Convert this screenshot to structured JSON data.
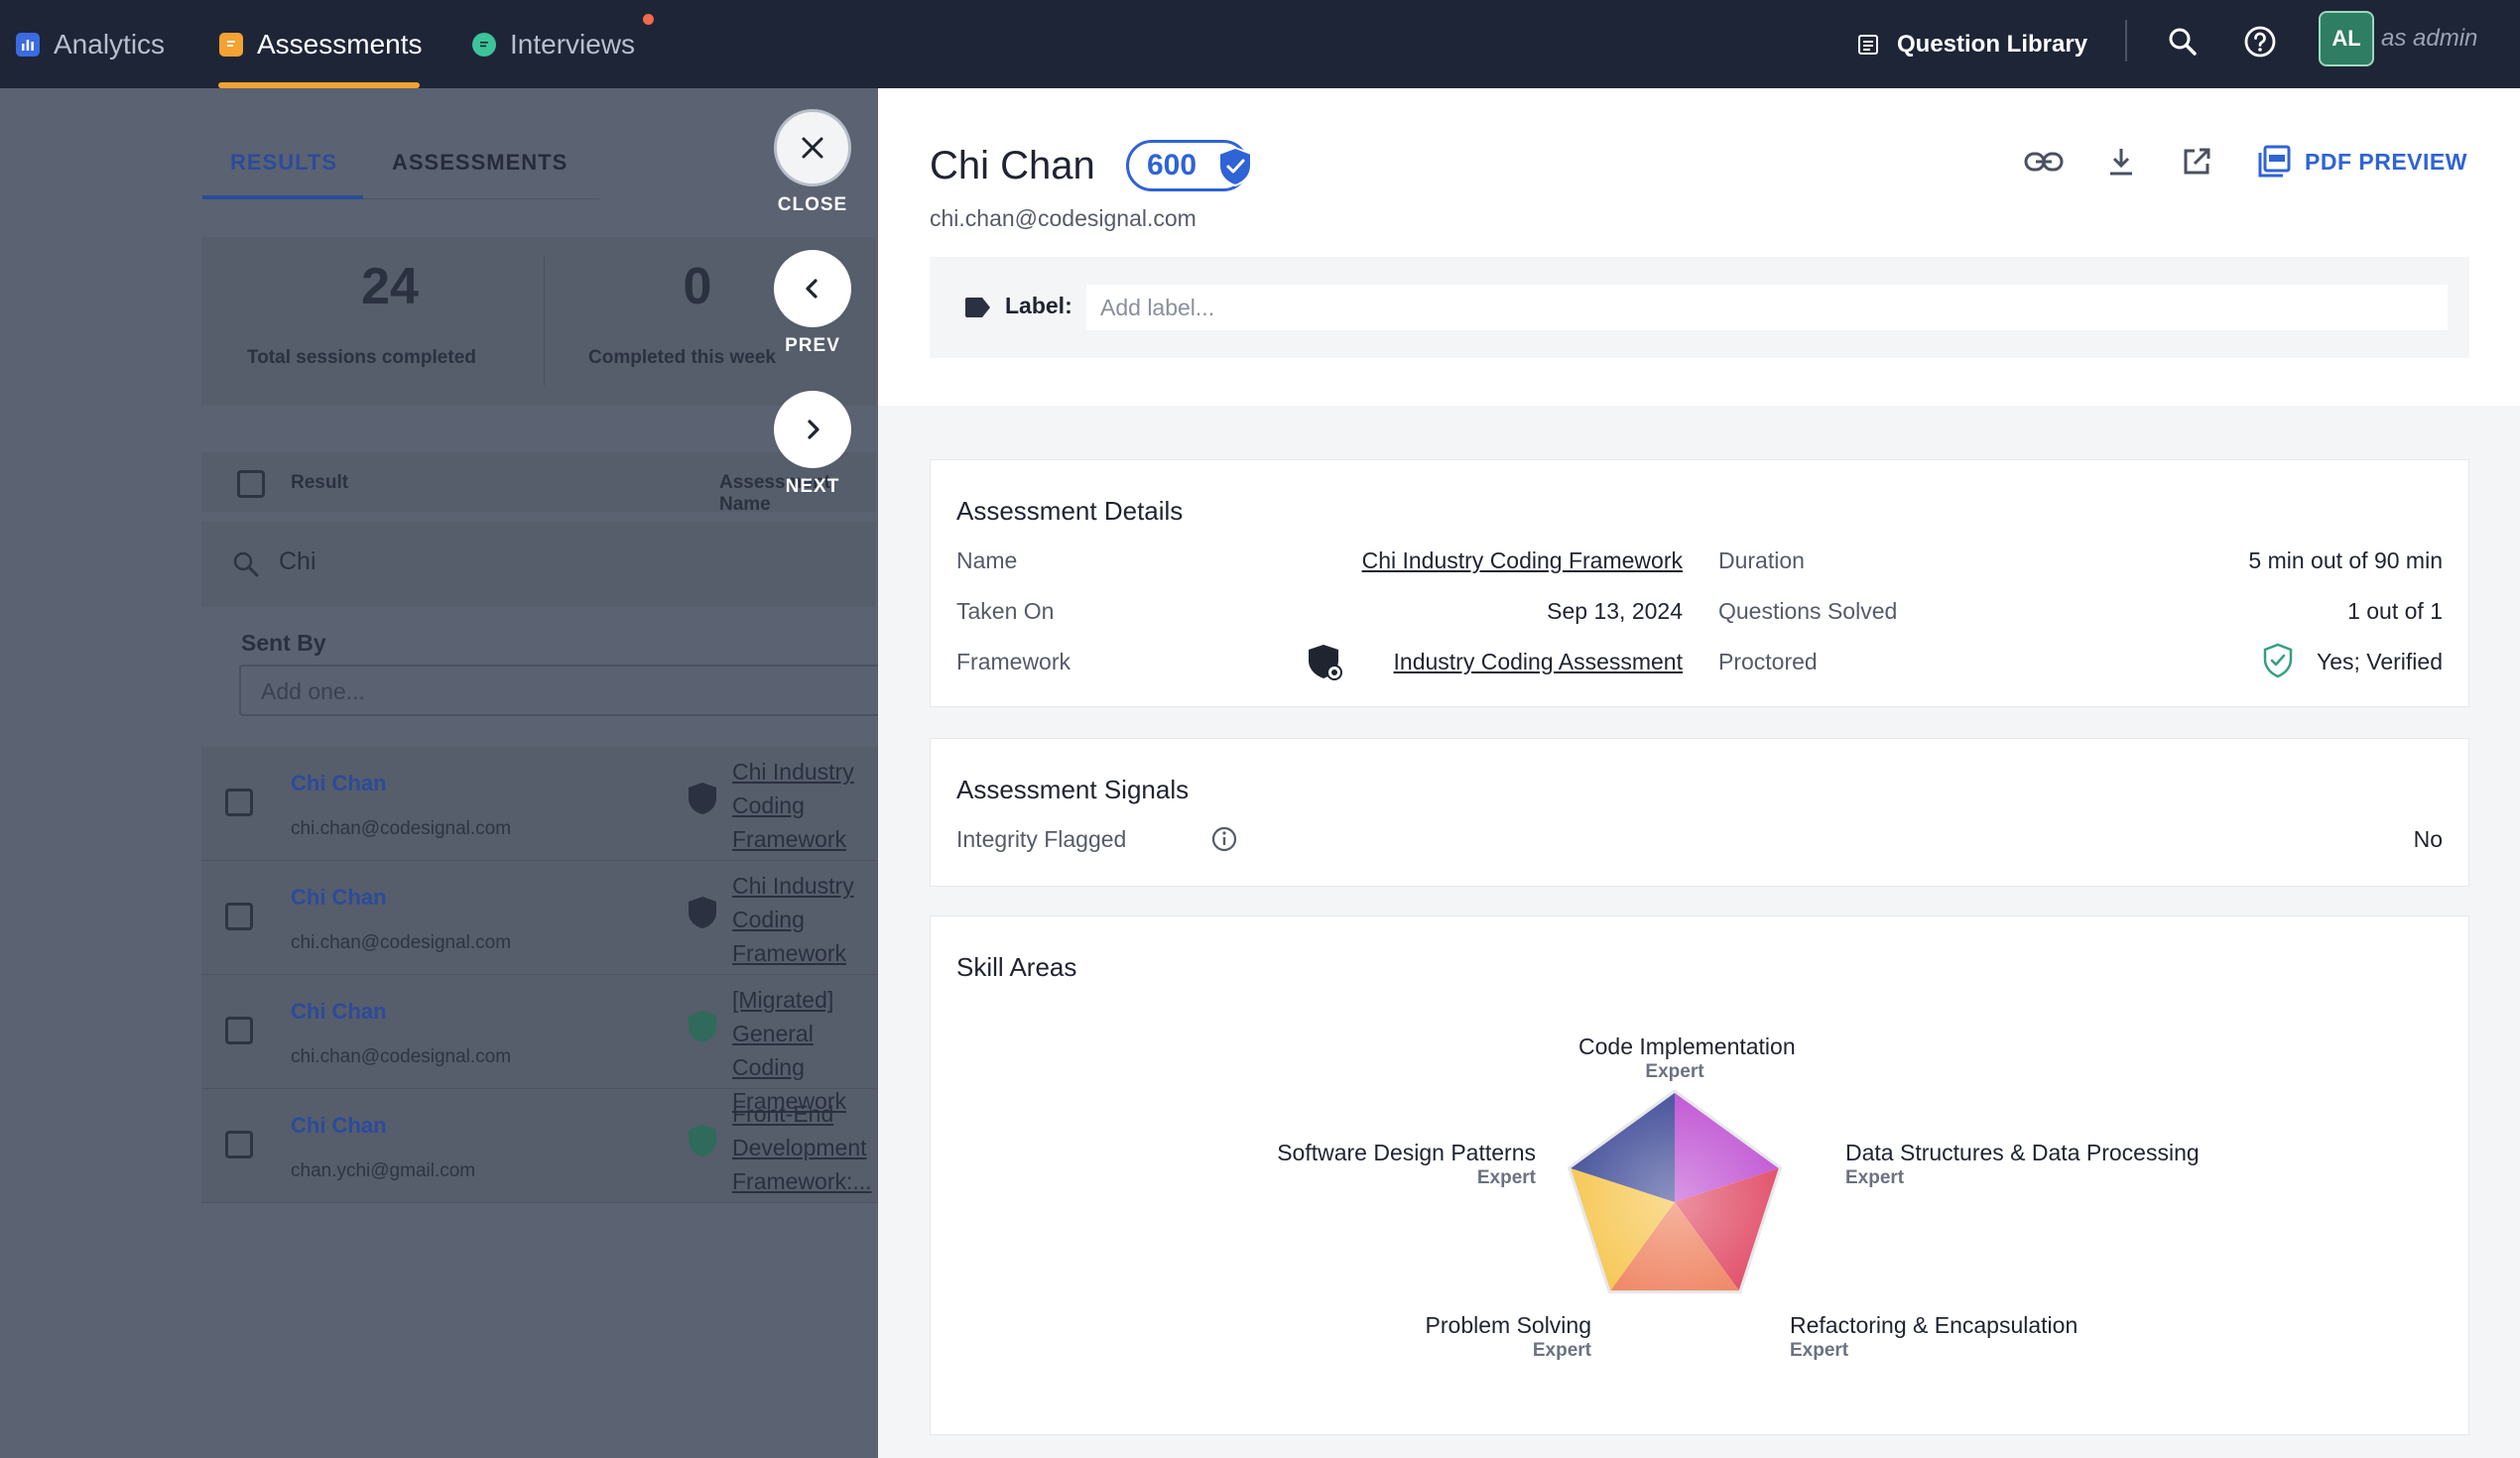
{
  "nav": {
    "analytics": "Analytics",
    "assessments": "Assessments",
    "interviews": "Interviews",
    "question_library": "Question Library",
    "avatar_initials": "AL",
    "role": "as admin"
  },
  "left_panel": {
    "tabs": [
      "RESULTS",
      "ASSESSMENTS"
    ],
    "stats": [
      {
        "value": "24",
        "label": "Total sessions completed"
      },
      {
        "value": "0",
        "label": "Completed this week"
      }
    ],
    "columns": {
      "result": "Result",
      "assessment": "Assessment Name"
    },
    "search_value": "Chi",
    "sent_by_label": "Sent By",
    "sent_by_placeholder": "Add one...",
    "rows": [
      {
        "name": "Chi Chan",
        "email": "chi.chan@codesignal.com",
        "framework": "Chi Industry Coding Framework"
      },
      {
        "name": "Chi Chan",
        "email": "chi.chan@codesignal.com",
        "framework": "Chi Industry Coding Framework"
      },
      {
        "name": "Chi Chan",
        "email": "chi.chan@codesignal.com",
        "framework": "[Migrated] General Coding Framework"
      },
      {
        "name": "Chi Chan",
        "email": "chan.ychi@gmail.com",
        "framework": "Front-End Development Framework:..."
      }
    ]
  },
  "controls": {
    "close": "CLOSE",
    "prev": "PREV",
    "next": "NEXT"
  },
  "candidate": {
    "name": "Chi Chan",
    "score": "600",
    "email": "chi.chan@codesignal.com",
    "pdf_preview": "PDF PREVIEW",
    "label_caption": "Label:",
    "label_placeholder": "Add label..."
  },
  "assessment_details": {
    "title": "Assessment Details",
    "name_key": "Name",
    "name_value": "Chi Industry Coding Framework",
    "taken_on_key": "Taken On",
    "taken_on_value": "Sep 13, 2024",
    "framework_key": "Framework",
    "framework_value": "Industry Coding Assessment",
    "duration_key": "Duration",
    "duration_value": "5 min out of 90 min",
    "questions_key": "Questions Solved",
    "questions_value": "1 out of 1",
    "proctored_key": "Proctored",
    "proctored_value": "Yes; Verified"
  },
  "assessment_signals": {
    "title": "Assessment Signals",
    "integrity_key": "Integrity Flagged",
    "integrity_value": "No"
  },
  "skill_areas": {
    "title": "Skill Areas",
    "skills": [
      {
        "name": "Code Implementation",
        "level": "Expert",
        "color": "#c45fd6"
      },
      {
        "name": "Data Structures & Data Processing",
        "level": "Expert",
        "color": "#e2566f"
      },
      {
        "name": "Refactoring & Encapsulation",
        "level": "Expert",
        "color": "#f08a6a"
      },
      {
        "name": "Problem Solving",
        "level": "Expert",
        "color": "#f7c95a"
      },
      {
        "name": "Software Design Patterns",
        "level": "Expert",
        "color": "#4f5aa0"
      }
    ]
  },
  "colors": {
    "brand_blue": "#2f63d6",
    "topbar": "#1e2537",
    "accent_orange": "#f4a233",
    "verified_green": "#34a07a"
  }
}
